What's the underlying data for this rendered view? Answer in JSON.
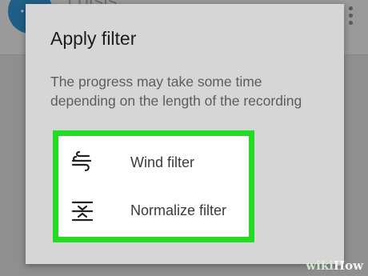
{
  "background": {
    "app_title": "Lotsis",
    "avatar_text": "•••"
  },
  "dialog": {
    "title": "Apply filter",
    "message": "The progress may take some time depending on the length of the recording",
    "options": [
      {
        "label": "Wind filter",
        "icon": "wind-icon"
      },
      {
        "label": "Normalize filter",
        "icon": "normalize-icon"
      }
    ]
  },
  "highlight_color": "#22dd22",
  "watermark": {
    "wiki": "wiki",
    "how": "How"
  }
}
